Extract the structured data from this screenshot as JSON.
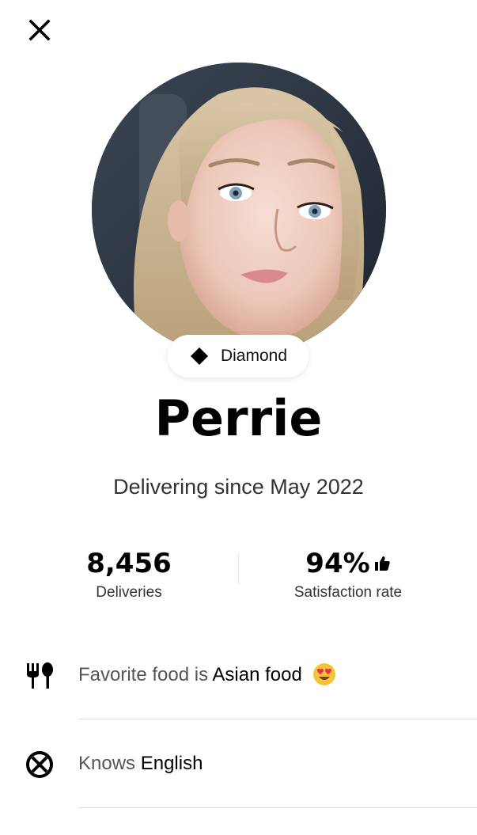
{
  "header": {
    "close_icon": "close-icon"
  },
  "profile": {
    "photo_icon": "profile-photo",
    "tier_label": "Diamond",
    "tier_icon": "diamond-icon",
    "name": "Perrie",
    "since": "Delivering since May 2022"
  },
  "stats": {
    "deliveries_value": "8,456",
    "deliveries_label": "Deliveries",
    "satisfaction_value": "94%",
    "satisfaction_icon": "thumbs-up-icon",
    "satisfaction_label": "Satisfaction rate"
  },
  "details": {
    "food": {
      "icon": "fork-spoon-icon",
      "prefix": "Favorite food is",
      "value": "Asian food",
      "emoji_icon": "heart-eyes-emoji-icon"
    },
    "language": {
      "icon": "globe-language-icon",
      "prefix": "Knows",
      "value": "English"
    }
  },
  "colors": {
    "background": "#ffffff",
    "text_primary": "#000000",
    "text_secondary": "#555555",
    "divider": "#e2e2e2"
  }
}
